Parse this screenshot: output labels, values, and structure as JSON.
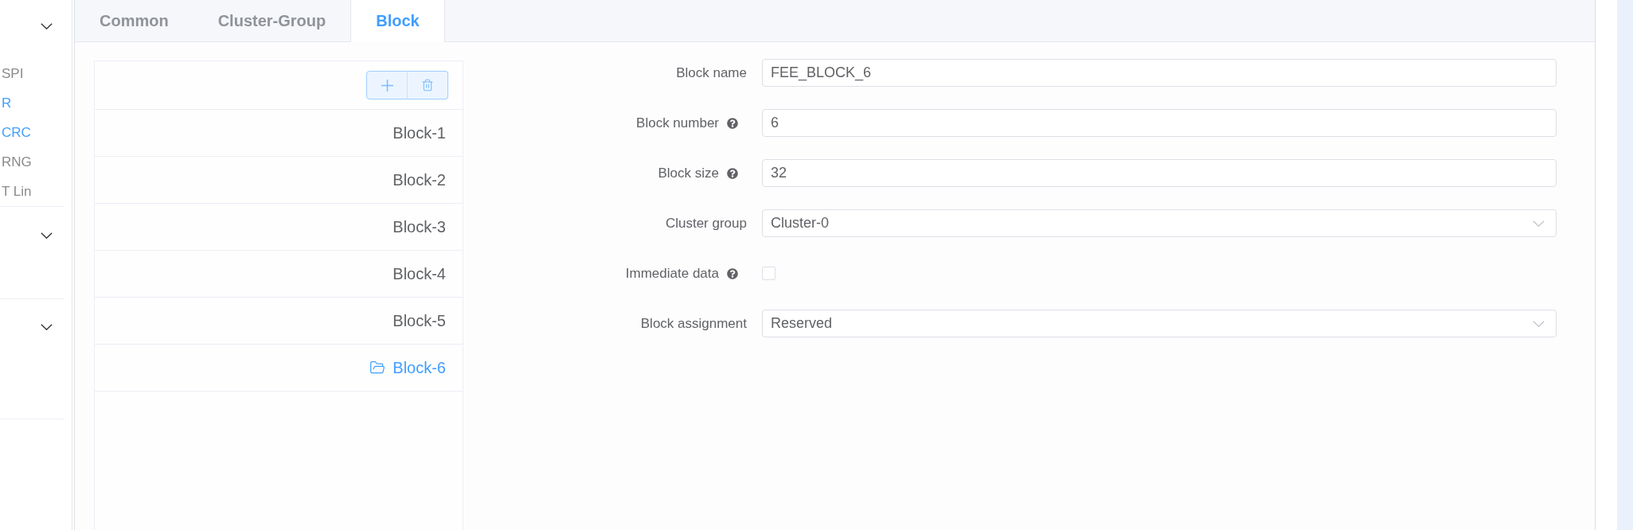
{
  "sidebar": {
    "items": [
      {
        "label": "SPI",
        "active": false
      },
      {
        "label": "R",
        "active": true
      },
      {
        "label": "CRC",
        "active": true
      },
      {
        "label": "RNG",
        "active": false
      },
      {
        "label": "T Lin",
        "active": false
      }
    ]
  },
  "tabs": [
    {
      "label": "Common",
      "selected": false
    },
    {
      "label": "Cluster-Group",
      "selected": false
    },
    {
      "label": "Block",
      "selected": true
    }
  ],
  "block_list": {
    "items": [
      {
        "label": "Block-1",
        "selected": false
      },
      {
        "label": "Block-2",
        "selected": false
      },
      {
        "label": "Block-3",
        "selected": false
      },
      {
        "label": "Block-4",
        "selected": false
      },
      {
        "label": "Block-5",
        "selected": false
      },
      {
        "label": "Block-6",
        "selected": true
      }
    ]
  },
  "form": {
    "fields": [
      {
        "kind": "text",
        "label": "Block name",
        "value": "FEE_BLOCK_6",
        "help": false
      },
      {
        "kind": "text",
        "label": "Block number",
        "value": "6",
        "help": true
      },
      {
        "kind": "text",
        "label": "Block size",
        "value": "32",
        "help": true
      },
      {
        "kind": "select",
        "label": "Cluster group",
        "value": "Cluster-0",
        "help": false
      },
      {
        "kind": "checkbox",
        "label": "Immediate data",
        "checked": false,
        "help": true
      },
      {
        "kind": "select",
        "label": "Block assignment",
        "value": "Reserved",
        "help": false
      }
    ]
  }
}
